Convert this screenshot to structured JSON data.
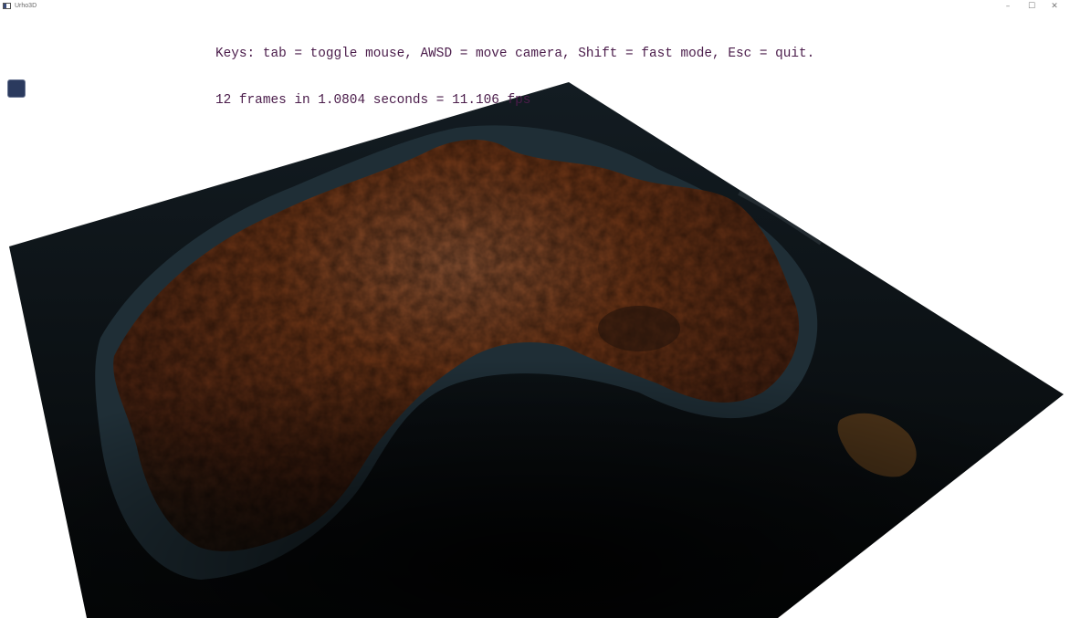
{
  "window": {
    "title": "Urho3D",
    "controls": {
      "minimize": "–",
      "maximize": "☐",
      "close": "✕"
    }
  },
  "hud": {
    "keys_line": "Keys: tab = toggle mouse, AWSD = move camera, Shift = fast mode, Esc = quit.",
    "fps_line": "12 frames in 1.0804 seconds = 11.106 fps"
  },
  "colors": {
    "hud_text": "#4a1c4a",
    "ocean": "#0c1216",
    "shallow_water": "#1e2c33",
    "land": "#7a3e1c",
    "land_dark": "#3a1c0e",
    "button": "#2b3a5e"
  },
  "icons": {
    "app": "app-window-icon",
    "button": "square-button"
  }
}
